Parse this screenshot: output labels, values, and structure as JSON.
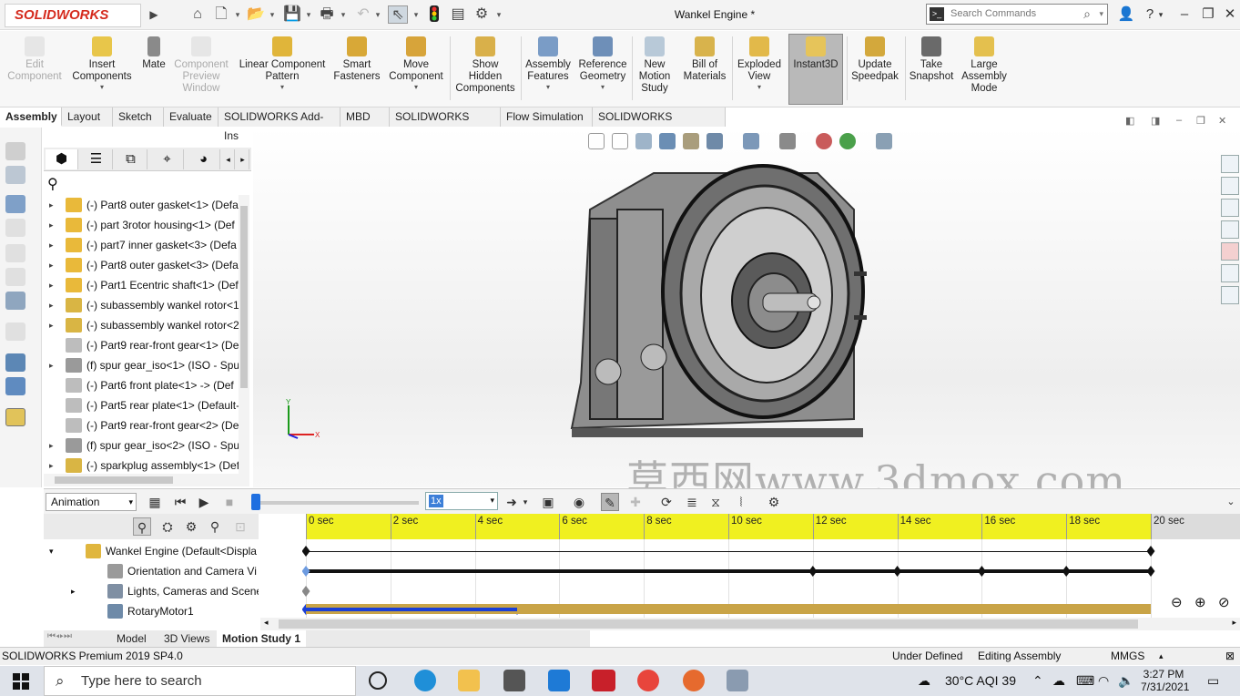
{
  "app": {
    "name": "SOLIDWORKS",
    "doc_title": "Wankel Engine *",
    "search_placeholder": "Search Commands"
  },
  "ribbon": {
    "buttons": [
      {
        "label": "Edit\nComponent",
        "enabled": false
      },
      {
        "label": "Insert\nComponents",
        "enabled": true
      },
      {
        "label": "Mate",
        "enabled": true
      },
      {
        "label": "Component\nPreview\nWindow",
        "enabled": false
      },
      {
        "label": "Linear Component\nPattern",
        "enabled": true
      },
      {
        "label": "Smart\nFasteners",
        "enabled": true
      },
      {
        "label": "Move\nComponent",
        "enabled": true
      },
      {
        "label": "Show\nHidden\nComponents",
        "enabled": true
      },
      {
        "label": "Assembly\nFeatures",
        "enabled": true
      },
      {
        "label": "Reference\nGeometry",
        "enabled": true
      },
      {
        "label": "New\nMotion\nStudy",
        "enabled": true
      },
      {
        "label": "Bill of\nMaterials",
        "enabled": true
      },
      {
        "label": "Exploded\nView",
        "enabled": true
      },
      {
        "label": "Instant3D",
        "enabled": true,
        "active": true
      },
      {
        "label": "Update\nSpeedpak",
        "enabled": true
      },
      {
        "label": "Take\nSnapshot",
        "enabled": true
      },
      {
        "label": "Large\nAssembly\nMode",
        "enabled": true
      }
    ]
  },
  "command_tabs": [
    "Assembly",
    "Layout",
    "Sketch",
    "Evaluate",
    "SOLIDWORKS Add-Ins",
    "MBD",
    "SOLIDWORKS CAM",
    "Flow Simulation",
    "SOLIDWORKS Inspection"
  ],
  "feature_tree": {
    "items": [
      {
        "label": "(-) Part8 outer gasket<1> (Defa",
        "icon": "part-icon",
        "exp": true
      },
      {
        "label": "(-) part 3rotor housing<1> (Def",
        "icon": "part-icon",
        "exp": true
      },
      {
        "label": "(-) part7 inner gasket<3> (Defa",
        "icon": "part-icon",
        "exp": true
      },
      {
        "label": "(-) Part8 outer gasket<3> (Defa",
        "icon": "part-icon",
        "exp": true
      },
      {
        "label": "(-) Part1 Ecentric shaft<1> (Def",
        "icon": "part-icon",
        "exp": true
      },
      {
        "label": "(-) subassembly wankel rotor<1",
        "icon": "subassembly-icon",
        "exp": true
      },
      {
        "label": "(-) subassembly wankel rotor<2",
        "icon": "subassembly-icon",
        "exp": true
      },
      {
        "label": "(-) Part9 rear-front gear<1> (De",
        "icon": "gear-part-icon",
        "exp": false
      },
      {
        "label": "(f) spur gear_iso<1> (ISO - Spur",
        "icon": "toolbox-icon",
        "exp": true
      },
      {
        "label": "(-) Part6 front plate<1> -> (Def",
        "icon": "gear-part-icon",
        "exp": false
      },
      {
        "label": "(-) Part5 rear plate<1> (Default-",
        "icon": "gear-part-icon",
        "exp": false
      },
      {
        "label": "(-) Part9 rear-front gear<2> (De",
        "icon": "gear-part-icon",
        "exp": false
      },
      {
        "label": "(f) spur gear_iso<2> (ISO - Spur",
        "icon": "toolbox-icon",
        "exp": true
      },
      {
        "label": "(-) sparkplug assembly<1> (Def",
        "icon": "subassembly-icon",
        "exp": true
      }
    ]
  },
  "watermark": "莫西网www.3dmox.com",
  "animation": {
    "study_type": "Animation",
    "speed": "1x",
    "tree": [
      {
        "label": "Wankel Engine  (Default<Displa",
        "icon": "assembly-icon",
        "indent": 0,
        "exp": "down"
      },
      {
        "label": "Orientation and Camera Vi",
        "icon": "camera-icon",
        "indent": 1,
        "exp": ""
      },
      {
        "label": "Lights, Cameras and Scene",
        "icon": "lights-icon",
        "indent": 1,
        "exp": "right"
      },
      {
        "label": "RotaryMotor1",
        "icon": "motor-icon",
        "indent": 1,
        "exp": ""
      }
    ],
    "time_ticks": [
      "0 sec",
      "2 sec",
      "4 sec",
      "6 sec",
      "8 sec",
      "10 sec",
      "12 sec",
      "14 sec",
      "16 sec",
      "18 sec",
      "20 sec"
    ],
    "time_max": 22,
    "orientation_keys": [
      0,
      12,
      14,
      16,
      18,
      20
    ],
    "motor_end": 5
  },
  "bottom_tabs": [
    "Model",
    "3D Views",
    "Motion Study 1"
  ],
  "status": {
    "product": "SOLIDWORKS Premium 2019 SP4.0",
    "state": "Under Defined",
    "mode": "Editing Assembly",
    "units": "MMGS"
  },
  "taskbar": {
    "search_placeholder": "Type here to search",
    "weather": "30°C  AQI 39",
    "time": "3:27 PM",
    "date": "7/31/2021"
  },
  "colors": {
    "accent": "#d52b1e",
    "timeline_ruler": "#f0f020",
    "motor_bar": "#c9a447",
    "motor_progress": "#1a3fd6",
    "active_tool": "#b9b9b9"
  }
}
